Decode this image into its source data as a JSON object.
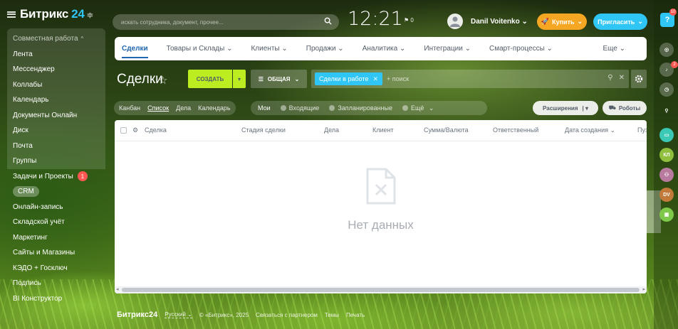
{
  "sidebar": {
    "logo_text": "Битрикс",
    "logo_number": "24",
    "group_label": "Совместная работа",
    "group_items": [
      "Лента",
      "Мессенджер",
      "Коллабы",
      "Календарь",
      "Документы Онлайн",
      "Диск",
      "Почта",
      "Группы"
    ],
    "items": [
      {
        "label": "Задачи и Проекты",
        "badge": "1"
      },
      {
        "label": "CRM",
        "active": true
      },
      {
        "label": "Онлайн-запись"
      },
      {
        "label": "Складской учёт"
      },
      {
        "label": "Маркетинг"
      },
      {
        "label": "Сайты и Магазины"
      },
      {
        "label": "КЭДО + Госключ"
      },
      {
        "label": "Подпись"
      },
      {
        "label": "BI Конструктор"
      }
    ]
  },
  "header": {
    "search_placeholder": "искать сотрудника, документ, прочее...",
    "time": "12:21",
    "flag_count": "0",
    "user_name": "Danil Voitenko",
    "buy_label": "Купить",
    "invite_label": "Пригласить"
  },
  "tabs": [
    "Сделки",
    "Товары и Склады",
    "Клиенты",
    "Продажи",
    "Аналитика",
    "Интеграции",
    "Смарт-процессы"
  ],
  "tabs_more": "Еще",
  "toolbar": {
    "title": "Сделки",
    "create_label": "СОЗДАТЬ",
    "category_label": "ОБЩАЯ",
    "filter_chip": "Сделки в работе",
    "filter_placeholder": "+ поиск"
  },
  "views": [
    "Канбан",
    "Список",
    "Дела",
    "Календарь"
  ],
  "counters": {
    "mine": "Мои",
    "items": [
      "Входящие",
      "Запланированные",
      "Ещё"
    ]
  },
  "extensions_label": "Расширения",
  "robots_label": "Роботы",
  "grid": {
    "columns": [
      "Сделка",
      "Стадия сделки",
      "Дела",
      "Клиент",
      "Сумма/Валюта",
      "Ответственный",
      "Дата создания",
      "Пуз"
    ],
    "empty_text": "Нет данных"
  },
  "footer": {
    "logo": "Битрикс24",
    "language": "Русский",
    "copyright": "© «Битрикс», 2025",
    "support": "Связаться с партнером",
    "themes": "Темы",
    "print": "Печать"
  },
  "rail": {
    "help_badge": "10",
    "notif_badge": "2",
    "avatars": [
      "КЛ",
      "DV"
    ]
  },
  "colors": {
    "accent_blue": "#2fc6f6",
    "create_green": "#bbed21",
    "buy_orange": "#f5a623",
    "badge_red": "#ff5752",
    "tab_active": "#2067b0"
  }
}
